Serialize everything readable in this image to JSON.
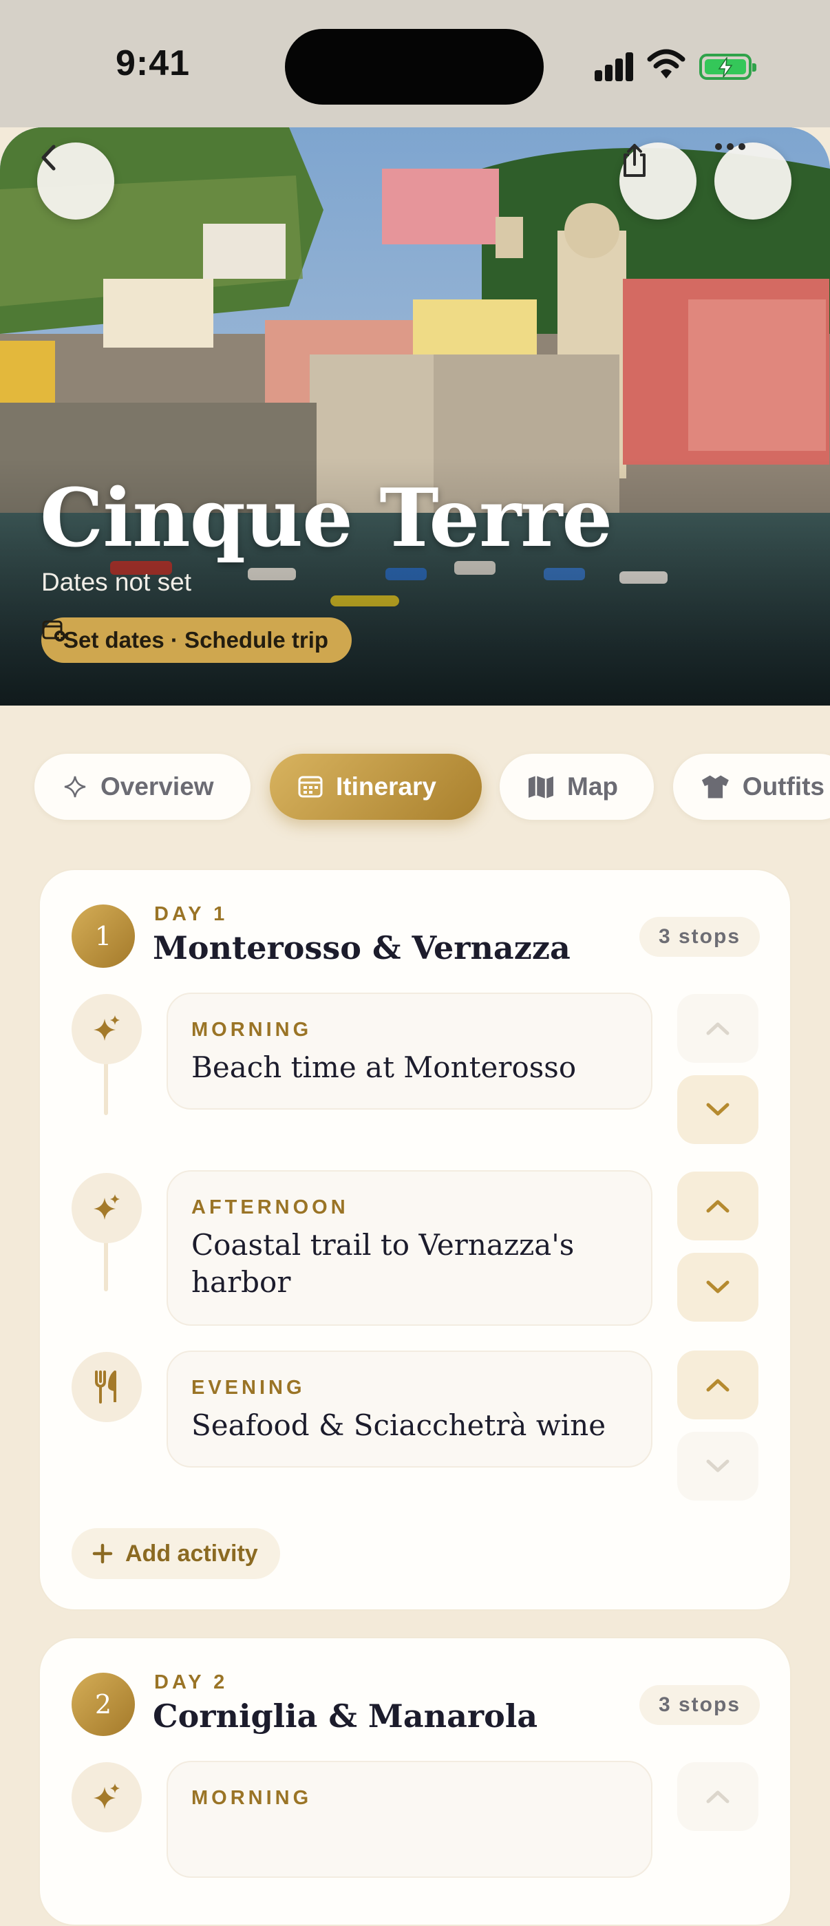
{
  "status_bar": {
    "time": "9:41"
  },
  "hero": {
    "title": "Cinque Terre",
    "subtitle": "Dates not set",
    "action_label": "Set dates · Schedule trip",
    "icons": {
      "back": "chevron-left-icon",
      "share": "share-icon",
      "more": "more-icon",
      "action": "calendar-plus-icon"
    }
  },
  "tabs": [
    {
      "label": "Overview",
      "icon": "sparkle-icon",
      "active": false
    },
    {
      "label": "Itinerary",
      "icon": "calendar-icon",
      "active": true
    },
    {
      "label": "Map",
      "icon": "map-icon",
      "active": false
    },
    {
      "label": "Outfits",
      "icon": "shirt-icon",
      "active": false
    }
  ],
  "days": [
    {
      "number": "1",
      "label": "DAY 1",
      "title": "Monterosso & Vernazza",
      "stops": "3 stops",
      "activities": [
        {
          "period": "MORNING",
          "title": "Beach time at Monterosso",
          "icon": "sparkle-icon"
        },
        {
          "period": "AFTERNOON",
          "title": "Coastal trail to Vernazza's harbor",
          "icon": "sparkle-icon"
        },
        {
          "period": "EVENING",
          "title": "Seafood & Sciacchetrà wine",
          "icon": "fork-knife-icon"
        }
      ],
      "add_label": "Add activity"
    },
    {
      "number": "2",
      "label": "DAY 2",
      "title": "Corniglia & Manarola",
      "stops": "3 stops",
      "activities": [
        {
          "period": "MORNING",
          "title": "",
          "icon": "sparkle-icon"
        }
      ]
    }
  ],
  "colors": {
    "accent": "#b88d38",
    "background": "#f3ead9",
    "card": "#fffefb"
  }
}
